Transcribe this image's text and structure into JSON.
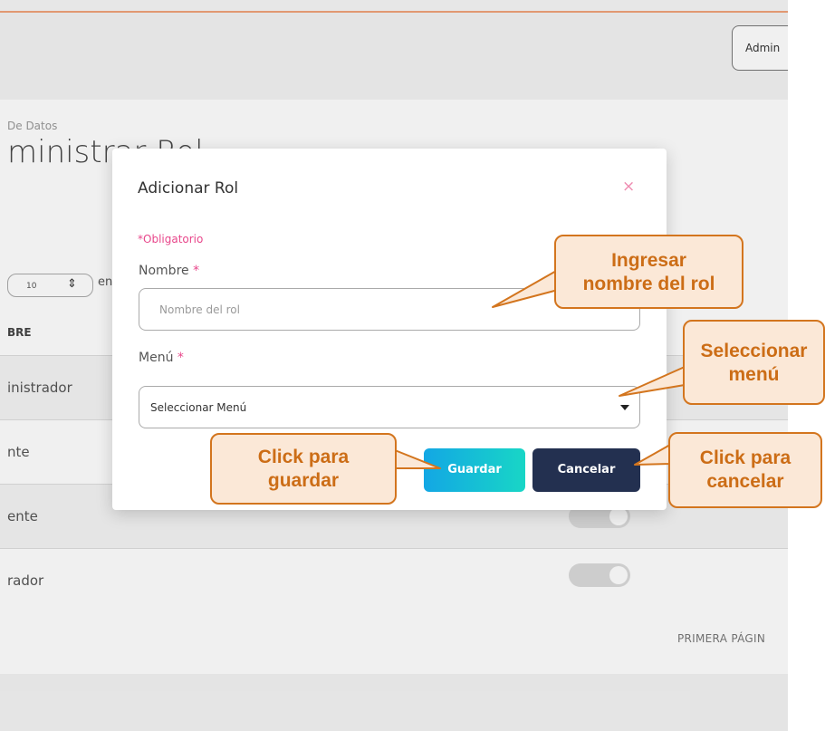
{
  "header": {
    "user_button": "Admin"
  },
  "breadcrumb": "De Datos",
  "page_title": "ministrar Rol",
  "table": {
    "page_size": "10",
    "page_size_suffix": "en",
    "column_header": "BRE",
    "rows": [
      "inistrador",
      "nte",
      "ente",
      "rador"
    ],
    "first_page_label": "PRIMERA PÁGIN"
  },
  "modal": {
    "title": "Adicionar Rol",
    "close_glyph": "×",
    "required_note": "*Obligatorio",
    "name_label": "Nombre",
    "name_placeholder": "Nombre del rol",
    "menu_label": "Menú",
    "menu_selected": "Seleccionar Menú",
    "required_star": "*",
    "save_label": "Guardar",
    "cancel_label": "Cancelar"
  },
  "callouts": {
    "name": [
      "Ingresar",
      "nombre del rol"
    ],
    "menu": [
      "Seleccionar",
      "menú"
    ],
    "save": [
      "Click para",
      "guardar"
    ],
    "cancel": [
      "Click para",
      "cancelar"
    ]
  },
  "colors": {
    "accent_pink": "#e8478b",
    "save_gradient_start": "#13a7e4",
    "save_gradient_end": "#18d6c6",
    "cancel_bg": "#233050",
    "callout_border": "#d3751e",
    "callout_fill": "#fbe8d7"
  },
  "icons": {
    "close": "close-icon",
    "select_caret": "chevron-down-icon",
    "page_size_arrows": "sort-arrows-icon"
  }
}
